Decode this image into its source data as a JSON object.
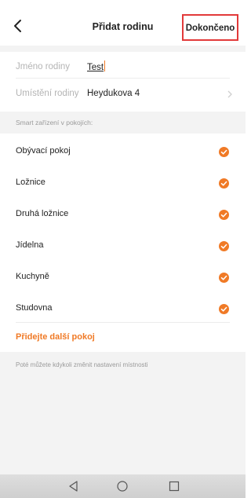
{
  "header": {
    "title": "Přidat rodinu",
    "done_label": "Dokončeno"
  },
  "form": {
    "name_label": "Jméno rodiny",
    "name_value": "Test",
    "location_label": "Umístění rodiny",
    "location_value": "Heydukova 4"
  },
  "rooms_caption": "Smart zařízení v pokojích:",
  "rooms": [
    {
      "label": "Obývací pokoj",
      "checked": true
    },
    {
      "label": "Ložnice",
      "checked": true
    },
    {
      "label": "Druhá ložnice",
      "checked": true
    },
    {
      "label": "Jídelna",
      "checked": true
    },
    {
      "label": "Kuchyně",
      "checked": true
    },
    {
      "label": "Studovna",
      "checked": true
    }
  ],
  "add_room_label": "Přidejte další pokoj",
  "footer_note": "Poté můžete kdykoli změnit nastavení místnosti",
  "icons": {
    "back": "chevron-left-icon",
    "location_chevron": "chevron-right-icon",
    "check": "check-circle-icon",
    "nav_back": "triangle-back-icon",
    "nav_home": "circle-home-icon",
    "nav_recents": "square-recents-icon"
  },
  "colors": {
    "accent": "#f07a26",
    "highlight_border": "#e23a3a",
    "background_gray": "#f3f3f3"
  }
}
